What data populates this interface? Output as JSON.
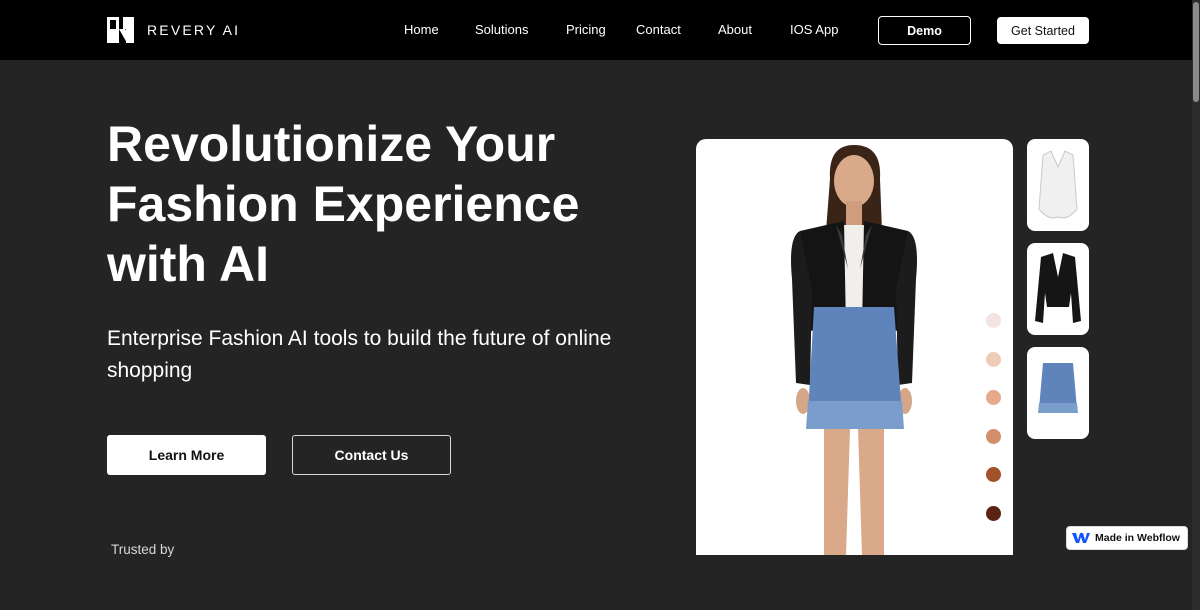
{
  "brand": {
    "name": "REVERY AI"
  },
  "nav": {
    "links": [
      "Home",
      "Solutions",
      "Pricing",
      "Contact",
      "About",
      "IOS App"
    ],
    "demo_label": "Demo",
    "get_started_label": "Get Started"
  },
  "hero": {
    "title": "Revolutionize Your Fashion Experience with AI",
    "subtitle": "Enterprise Fashion AI tools to build the future of online shopping",
    "learn_more_label": "Learn More",
    "contact_label": "Contact Us",
    "trusted_label": "Trusted by"
  },
  "showcase": {
    "thumbnails": [
      "white-corset-top",
      "black-leather-jacket",
      "blue-tweed-skirt"
    ],
    "skin_tones": [
      "#f3e3e3",
      "#efccb8",
      "#e6a98a",
      "#d38f6c",
      "#a2512b",
      "#5a2210"
    ]
  },
  "badge": {
    "label": "Made in Webflow"
  },
  "colors": {
    "background": "#242424",
    "nav_background": "#000000",
    "accent": "#ffffff"
  }
}
